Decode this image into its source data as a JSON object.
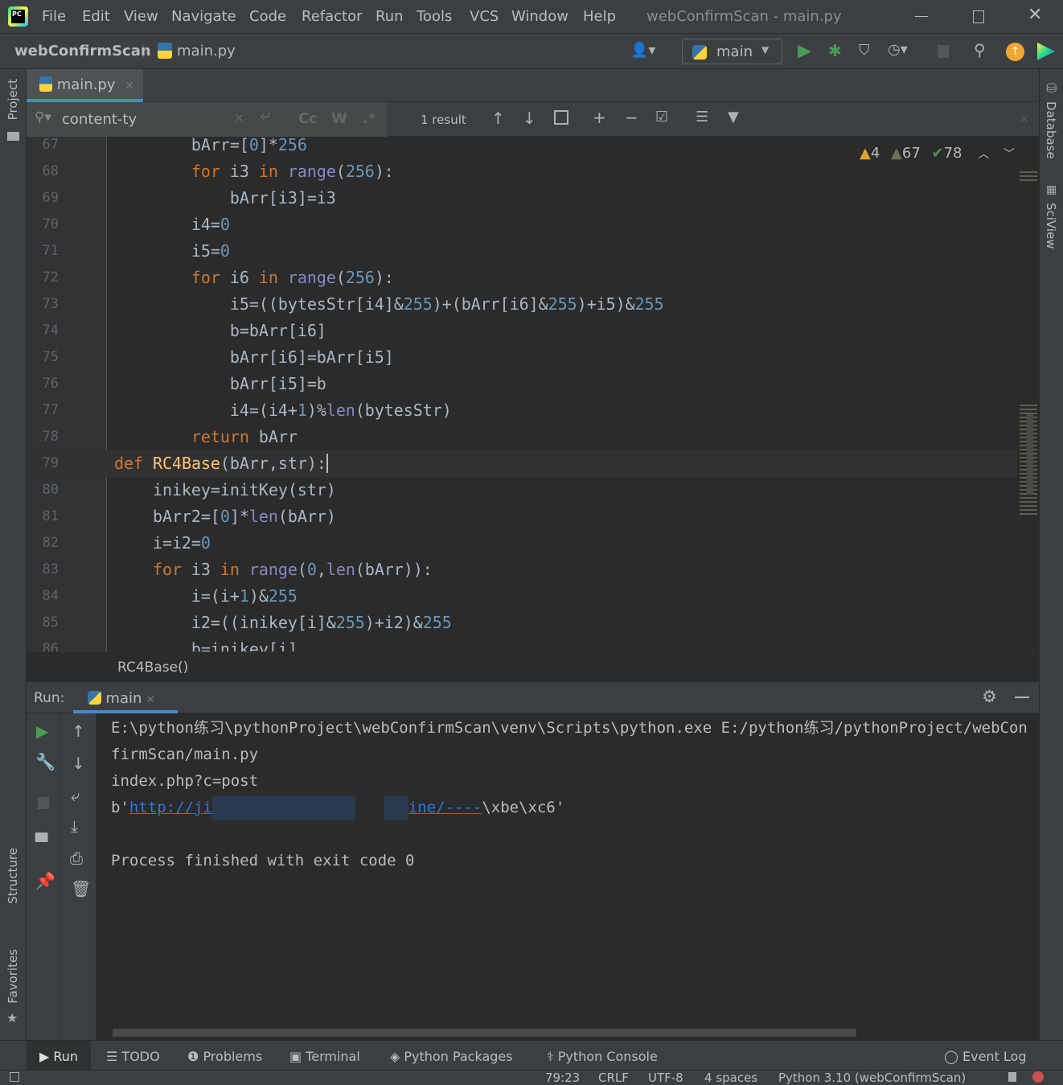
{
  "window": {
    "title": "webConfirmScan - main.py"
  },
  "menu": [
    "File",
    "Edit",
    "View",
    "Navigate",
    "Code",
    "Refactor",
    "Run",
    "Tools",
    "VCS",
    "Window",
    "Help"
  ],
  "menu_mnemonics": [
    "F",
    "E",
    "V",
    "N",
    "C",
    "R",
    "u",
    "T",
    "S",
    "W",
    "H"
  ],
  "breadcrumb": {
    "project": "webConfirmScan",
    "file": "main.py"
  },
  "run_config": "main",
  "editor_tab": {
    "label": "main.py"
  },
  "search": {
    "value": "content-ty",
    "result": "1 result",
    "case_label": "Cc",
    "word_label": "W",
    "regex_label": ".*"
  },
  "inspections": {
    "warnings": "4",
    "weak_warnings": "67",
    "typos": "78"
  },
  "side_tools": {
    "project": "Project",
    "structure": "Structure",
    "favorites": "Favorites",
    "database": "Database",
    "sciview": "SciView"
  },
  "code_lines": [
    {
      "no": "67",
      "tokens": [
        [
          "p",
          "        bArr=["
        ],
        [
          "n",
          "0"
        ],
        [
          "p",
          "]*"
        ],
        [
          "n",
          "256"
        ]
      ]
    },
    {
      "no": "68",
      "tokens": [
        [
          "k",
          "        for"
        ],
        [
          "p",
          " i3 "
        ],
        [
          "k",
          "in"
        ],
        [
          "p",
          " "
        ],
        [
          "b",
          "range"
        ],
        [
          "p",
          "("
        ],
        [
          "n",
          "256"
        ],
        [
          "p",
          "):"
        ]
      ]
    },
    {
      "no": "69",
      "tokens": [
        [
          "p",
          "            bArr[i3]=i3"
        ]
      ]
    },
    {
      "no": "70",
      "tokens": [
        [
          "p",
          "        i4="
        ],
        [
          "n",
          "0"
        ]
      ]
    },
    {
      "no": "71",
      "tokens": [
        [
          "p",
          "        i5="
        ],
        [
          "n",
          "0"
        ]
      ]
    },
    {
      "no": "72",
      "tokens": [
        [
          "k",
          "        for"
        ],
        [
          "p",
          " i6 "
        ],
        [
          "k",
          "in"
        ],
        [
          "p",
          " "
        ],
        [
          "b",
          "range"
        ],
        [
          "p",
          "("
        ],
        [
          "n",
          "256"
        ],
        [
          "p",
          "):"
        ]
      ]
    },
    {
      "no": "73",
      "tokens": [
        [
          "p",
          "            i5=((bytesStr[i4]&"
        ],
        [
          "n",
          "255"
        ],
        [
          "p",
          ")+(bArr[i6]&"
        ],
        [
          "n",
          "255"
        ],
        [
          "p",
          ")+i5)&"
        ],
        [
          "n",
          "255"
        ]
      ]
    },
    {
      "no": "74",
      "tokens": [
        [
          "p",
          "            b=bArr[i6]"
        ]
      ]
    },
    {
      "no": "75",
      "tokens": [
        [
          "p",
          "            bArr[i6]=bArr[i5]"
        ]
      ]
    },
    {
      "no": "76",
      "tokens": [
        [
          "p",
          "            bArr[i5]=b"
        ]
      ]
    },
    {
      "no": "77",
      "tokens": [
        [
          "p",
          "            i4=(i4+"
        ],
        [
          "n",
          "1"
        ],
        [
          "p",
          ")%"
        ],
        [
          "b",
          "len"
        ],
        [
          "p",
          "(bytesStr)"
        ]
      ]
    },
    {
      "no": "78",
      "tokens": [
        [
          "k",
          "        return"
        ],
        [
          "p",
          " bArr"
        ]
      ]
    },
    {
      "no": "79",
      "tokens": [
        [
          "k",
          "def"
        ],
        [
          "p",
          " "
        ],
        [
          "f",
          "RC4Base"
        ],
        [
          "p",
          "(bArr,str):"
        ]
      ],
      "current": true
    },
    {
      "no": "80",
      "tokens": [
        [
          "p",
          "    inikey=initKey(str)"
        ]
      ]
    },
    {
      "no": "81",
      "tokens": [
        [
          "p",
          "    bArr2=["
        ],
        [
          "n",
          "0"
        ],
        [
          "p",
          "]*"
        ],
        [
          "b",
          "len"
        ],
        [
          "p",
          "(bArr)"
        ]
      ]
    },
    {
      "no": "82",
      "tokens": [
        [
          "p",
          "    i=i2="
        ],
        [
          "n",
          "0"
        ]
      ]
    },
    {
      "no": "83",
      "tokens": [
        [
          "k",
          "    for"
        ],
        [
          "p",
          " i3 "
        ],
        [
          "k",
          "in"
        ],
        [
          "p",
          " "
        ],
        [
          "b",
          "range"
        ],
        [
          "p",
          "("
        ],
        [
          "n",
          "0"
        ],
        [
          "p",
          ","
        ],
        [
          "b",
          "len"
        ],
        [
          "p",
          "(bArr)):"
        ]
      ]
    },
    {
      "no": "84",
      "tokens": [
        [
          "p",
          "        i=(i+"
        ],
        [
          "n",
          "1"
        ],
        [
          "p",
          ")&"
        ],
        [
          "n",
          "255"
        ]
      ]
    },
    {
      "no": "85",
      "tokens": [
        [
          "p",
          "        i2=((inikey[i]&"
        ],
        [
          "n",
          "255"
        ],
        [
          "p",
          ")+i2)&"
        ],
        [
          "n",
          "255"
        ]
      ]
    },
    {
      "no": "86",
      "tokens": [
        [
          "p",
          "        b=inikey[i]"
        ]
      ]
    }
  ],
  "editor_breadcrumb": "RC4Base()",
  "run_panel": {
    "label": "Run:",
    "tab": "main",
    "output": {
      "line1": "E:\\python练习\\pythonProject\\webConfirmScan\\venv\\Scripts\\python.exe E:/python练习/pythonProject/webConfirmScan/main.py",
      "line2": "index.php?c=post",
      "line3_prefix": "b'",
      "line3_link_start": "http://ji",
      "line3_link_end": "ine/----",
      "line3_suffix": "\\xbe\\xc6'",
      "line5": "Process finished with exit code 0"
    }
  },
  "bottom_tabs": [
    "Run",
    "TODO",
    "Problems",
    "Terminal",
    "Python Packages",
    "Python Console"
  ],
  "event_log": "Event Log",
  "status": {
    "position": "79:23",
    "line_sep": "CRLF",
    "encoding": "UTF-8",
    "indent": "4 spaces",
    "interpreter": "Python 3.10 (webConfirmScan)"
  },
  "colors": {
    "accent": "#4a88c7",
    "keyword": "#cc7832",
    "number": "#6897bb",
    "builtin": "#8888c6",
    "function": "#ffc66d",
    "run_green": "#499c54",
    "link": "#287bde",
    "warning": "#e0a22e"
  }
}
